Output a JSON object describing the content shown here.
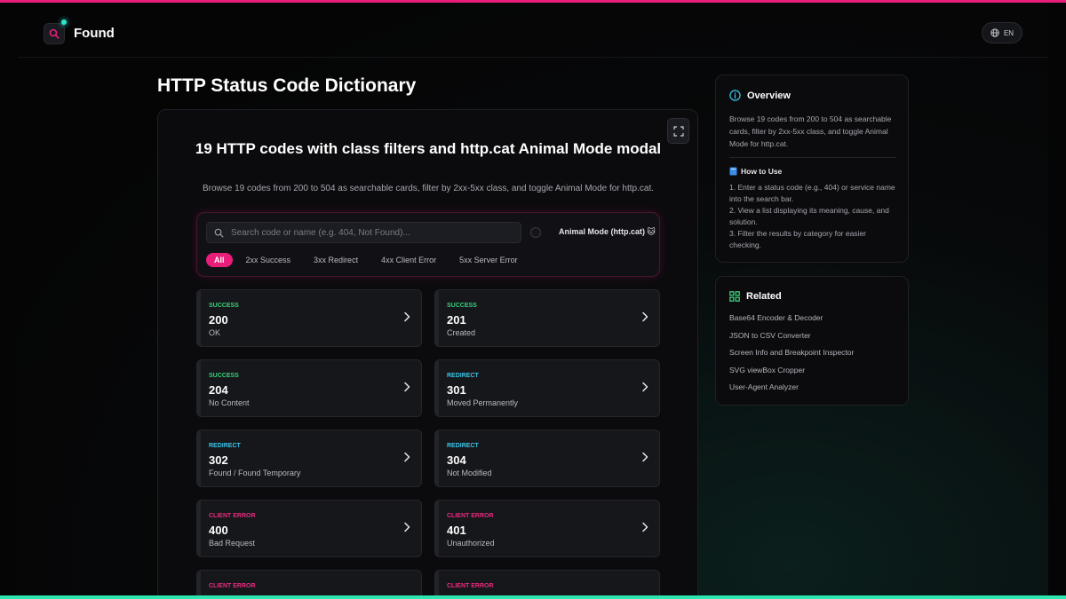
{
  "header": {
    "brand": "Found",
    "lang_label": "EN"
  },
  "page_title": "HTTP Status Code Dictionary",
  "hero": {
    "title": "19 HTTP codes with class filters and http.cat Animal Mode modal",
    "subtitle": "Browse 19 codes from 200 to 504 as searchable cards, filter by 2xx-5xx class, and toggle Animal Mode for http.cat."
  },
  "search": {
    "placeholder": "Search code or name (e.g. 404, Not Found)...",
    "value": "",
    "animal_mode_label": "Animal Mode (http.cat) 🐱"
  },
  "filters": [
    {
      "label": "All",
      "active": true
    },
    {
      "label": "2xx Success",
      "active": false
    },
    {
      "label": "3xx Redirect",
      "active": false
    },
    {
      "label": "4xx Client Error",
      "active": false
    },
    {
      "label": "5xx Server Error",
      "active": false
    }
  ],
  "codes": [
    {
      "category": "SUCCESS",
      "code": "200",
      "name": "OK"
    },
    {
      "category": "SUCCESS",
      "code": "201",
      "name": "Created"
    },
    {
      "category": "SUCCESS",
      "code": "204",
      "name": "No Content"
    },
    {
      "category": "REDIRECT",
      "code": "301",
      "name": "Moved Permanently"
    },
    {
      "category": "REDIRECT",
      "code": "302",
      "name": "Found / Found Temporary"
    },
    {
      "category": "REDIRECT",
      "code": "304",
      "name": "Not Modified"
    },
    {
      "category": "CLIENT ERROR",
      "code": "400",
      "name": "Bad Request"
    },
    {
      "category": "CLIENT ERROR",
      "code": "401",
      "name": "Unauthorized"
    },
    {
      "category": "CLIENT ERROR",
      "code": "",
      "name": ""
    },
    {
      "category": "CLIENT ERROR",
      "code": "",
      "name": ""
    }
  ],
  "overview": {
    "title": "Overview",
    "text": "Browse 19 codes from 200 to 504 as searchable cards, filter by 2xx-5xx class, and toggle Animal Mode for http.cat.",
    "howto_title": "How to Use",
    "steps": [
      "1. Enter a status code (e.g., 404) or service name into the search bar.",
      "2. View a list displaying its meaning, cause, and solution.",
      "3. Filter the results by category for easier checking."
    ]
  },
  "related": {
    "title": "Related",
    "links": [
      "Base64 Encoder & Decoder",
      "JSON to CSV Converter",
      "Screen Info and Breakpoint Inspector",
      "SVG viewBox Cropper",
      "User-Agent Analyzer"
    ]
  },
  "colors": {
    "accent": "#e91e7a",
    "teal": "#2ee6b0",
    "success": "#3ad07a",
    "redirect": "#3bc6e8",
    "client_error": "#e92a7e"
  }
}
